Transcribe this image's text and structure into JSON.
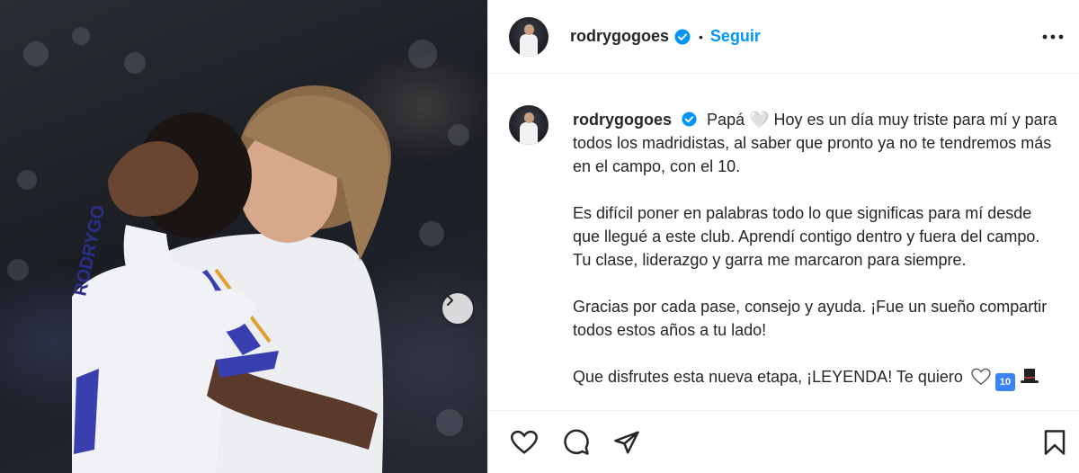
{
  "post": {
    "username": "rodrygogoes",
    "follow_label": "Seguir",
    "separator": "•",
    "caption_paragraphs": [
      "Papá 🤍 Hoy es un día muy triste para mí y para todos los madridistas, al saber que pronto ya no te tendremos más en el campo, con el 10.",
      "Es difícil poner en palabras todo lo que significas para mí desde que llegué a este club. Aprendí contigo dentro y fuera del campo. Tu clase, liderazgo y garra me marcaron para siempre.",
      "Gracias por cada pase, consejo y ayuda. ¡Fue un sueño compartir todos estos años a tu lado!"
    ],
    "last_line": "Que disfrutes esta nueva etapa, ¡LEYENDA! Te quiero",
    "ten_badge": "10",
    "jersey_name": "RODRYGO"
  },
  "icons": {
    "verified": "verified-badge-icon",
    "more": "more-options-icon",
    "next": "chevron-right-icon",
    "like": "heart-icon",
    "comment": "comment-icon",
    "share": "share-icon",
    "save": "bookmark-icon"
  },
  "colors": {
    "accent": "#0095f6",
    "text": "#262626",
    "border": "#efefef"
  }
}
